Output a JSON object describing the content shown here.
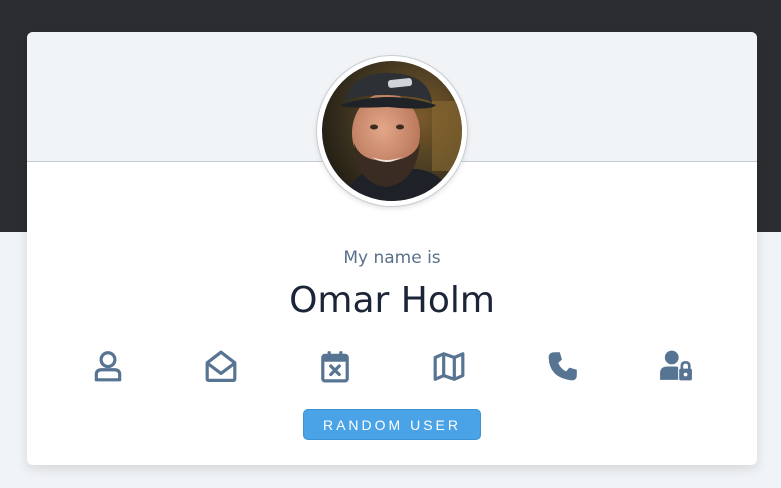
{
  "colors": {
    "top_band": "#2b2d31",
    "page_bg": "#f1f4f7",
    "card_bg": "#ffffff",
    "icon": "#587493",
    "button": "#4aa3e6"
  },
  "profile": {
    "subtitle": "My name is",
    "name": "Omar Holm"
  },
  "icons": [
    {
      "name": "user-icon"
    },
    {
      "name": "envelope-open-icon"
    },
    {
      "name": "calendar-x-icon"
    },
    {
      "name": "map-icon"
    },
    {
      "name": "phone-icon"
    },
    {
      "name": "user-lock-icon"
    }
  ],
  "button": {
    "label": "Random User"
  }
}
